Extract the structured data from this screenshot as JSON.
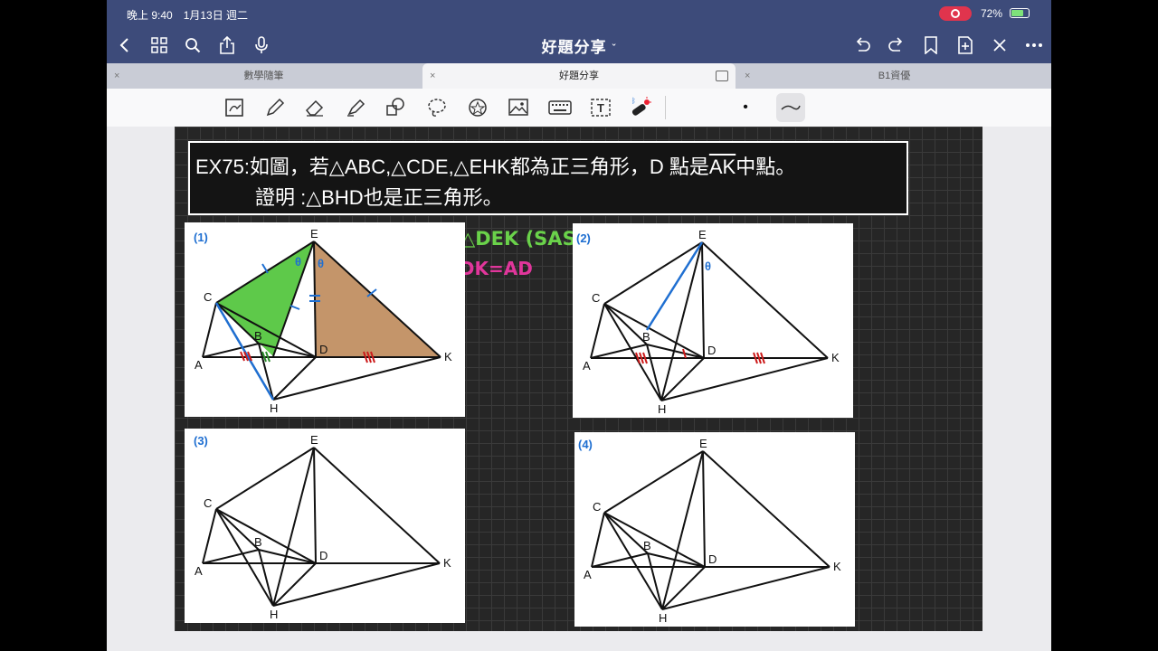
{
  "status_bar": {
    "time": "晚上 9:40　1月13日 週二",
    "battery_percent": "72%",
    "battery_level": 0.72
  },
  "navbar": {
    "title": "好題分享",
    "title_chevron": "ˇ"
  },
  "tabs": [
    {
      "label": "數學隨筆",
      "active": false
    },
    {
      "label": "好題分享",
      "active": true
    },
    {
      "label": "B1資優",
      "active": false
    }
  ],
  "tab_close": "×",
  "toolbar": {
    "tools": [
      "lasso-select-icon",
      "pen-icon",
      "eraser-icon",
      "highlighter-icon",
      "shapes-icon",
      "lasso-icon",
      "sticker-icon",
      "image-icon",
      "keyboard-icon",
      "text-icon",
      "laser-pointer-icon",
      "dot-size-icon",
      "stroke-style-icon"
    ],
    "dot": "•"
  },
  "problem": {
    "line1_prefix": "EX75:如圖，若△ABC,△CDE,△EHK都為正三角形，D 點是",
    "line1_overline": "AK",
    "line1_suffix": "中點。",
    "line2": "證明 :△BHD也是正三角形。"
  },
  "annotations": {
    "congruence": "△CEH≅△DEK (SAS)",
    "equality": "⇒ CH=DK=AD"
  },
  "figures": [
    {
      "tag": "(1)"
    },
    {
      "tag": "(2)"
    },
    {
      "tag": "(3)"
    },
    {
      "tag": "(4)"
    }
  ],
  "point_labels": {
    "A": "A",
    "B": "B",
    "C": "C",
    "D": "D",
    "E": "E",
    "H": "H",
    "K": "K"
  },
  "angle_symbol": "θ",
  "colors": {
    "nav": "#3d4b7a",
    "green_fill": "#5ec94a",
    "brown_fill": "#c4956a",
    "blue": "#1f6fd1",
    "red": "#cc1a1a",
    "green_text": "#6ad24a",
    "pink_text": "#e0369b"
  }
}
